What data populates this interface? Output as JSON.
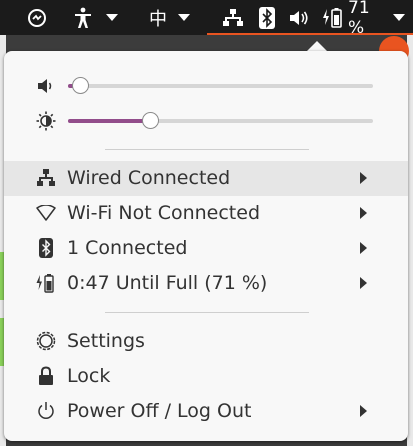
{
  "topbar": {
    "ime_label": "中",
    "battery_percent_label": "71 %",
    "accent_color": "#e95420"
  },
  "sliders": {
    "volume": {
      "icon": "speaker-icon",
      "level": 0.04
    },
    "brightness": {
      "icon": "brightness-icon",
      "level": 0.27
    }
  },
  "menu": {
    "items": [
      {
        "label": "Wired Connected",
        "icon": "wired-network-icon",
        "submenu": true
      },
      {
        "label": "Wi-Fi Not Connected",
        "icon": "wifi-icon",
        "submenu": true
      },
      {
        "label": "1 Connected",
        "icon": "bluetooth-icon",
        "submenu": true
      },
      {
        "label": "0:47 Until Full (71 %)",
        "icon": "battery-charging-icon",
        "submenu": true
      },
      {
        "label": "Settings",
        "icon": "settings-gear-icon",
        "submenu": false
      },
      {
        "label": "Lock",
        "icon": "lock-icon",
        "submenu": false
      },
      {
        "label": "Power Off / Log Out",
        "icon": "power-icon",
        "submenu": true
      }
    ]
  },
  "colors": {
    "slider_fill": "#924d8b",
    "menu_background": "#f8f8f8",
    "highlight": "#e6e6e6"
  }
}
